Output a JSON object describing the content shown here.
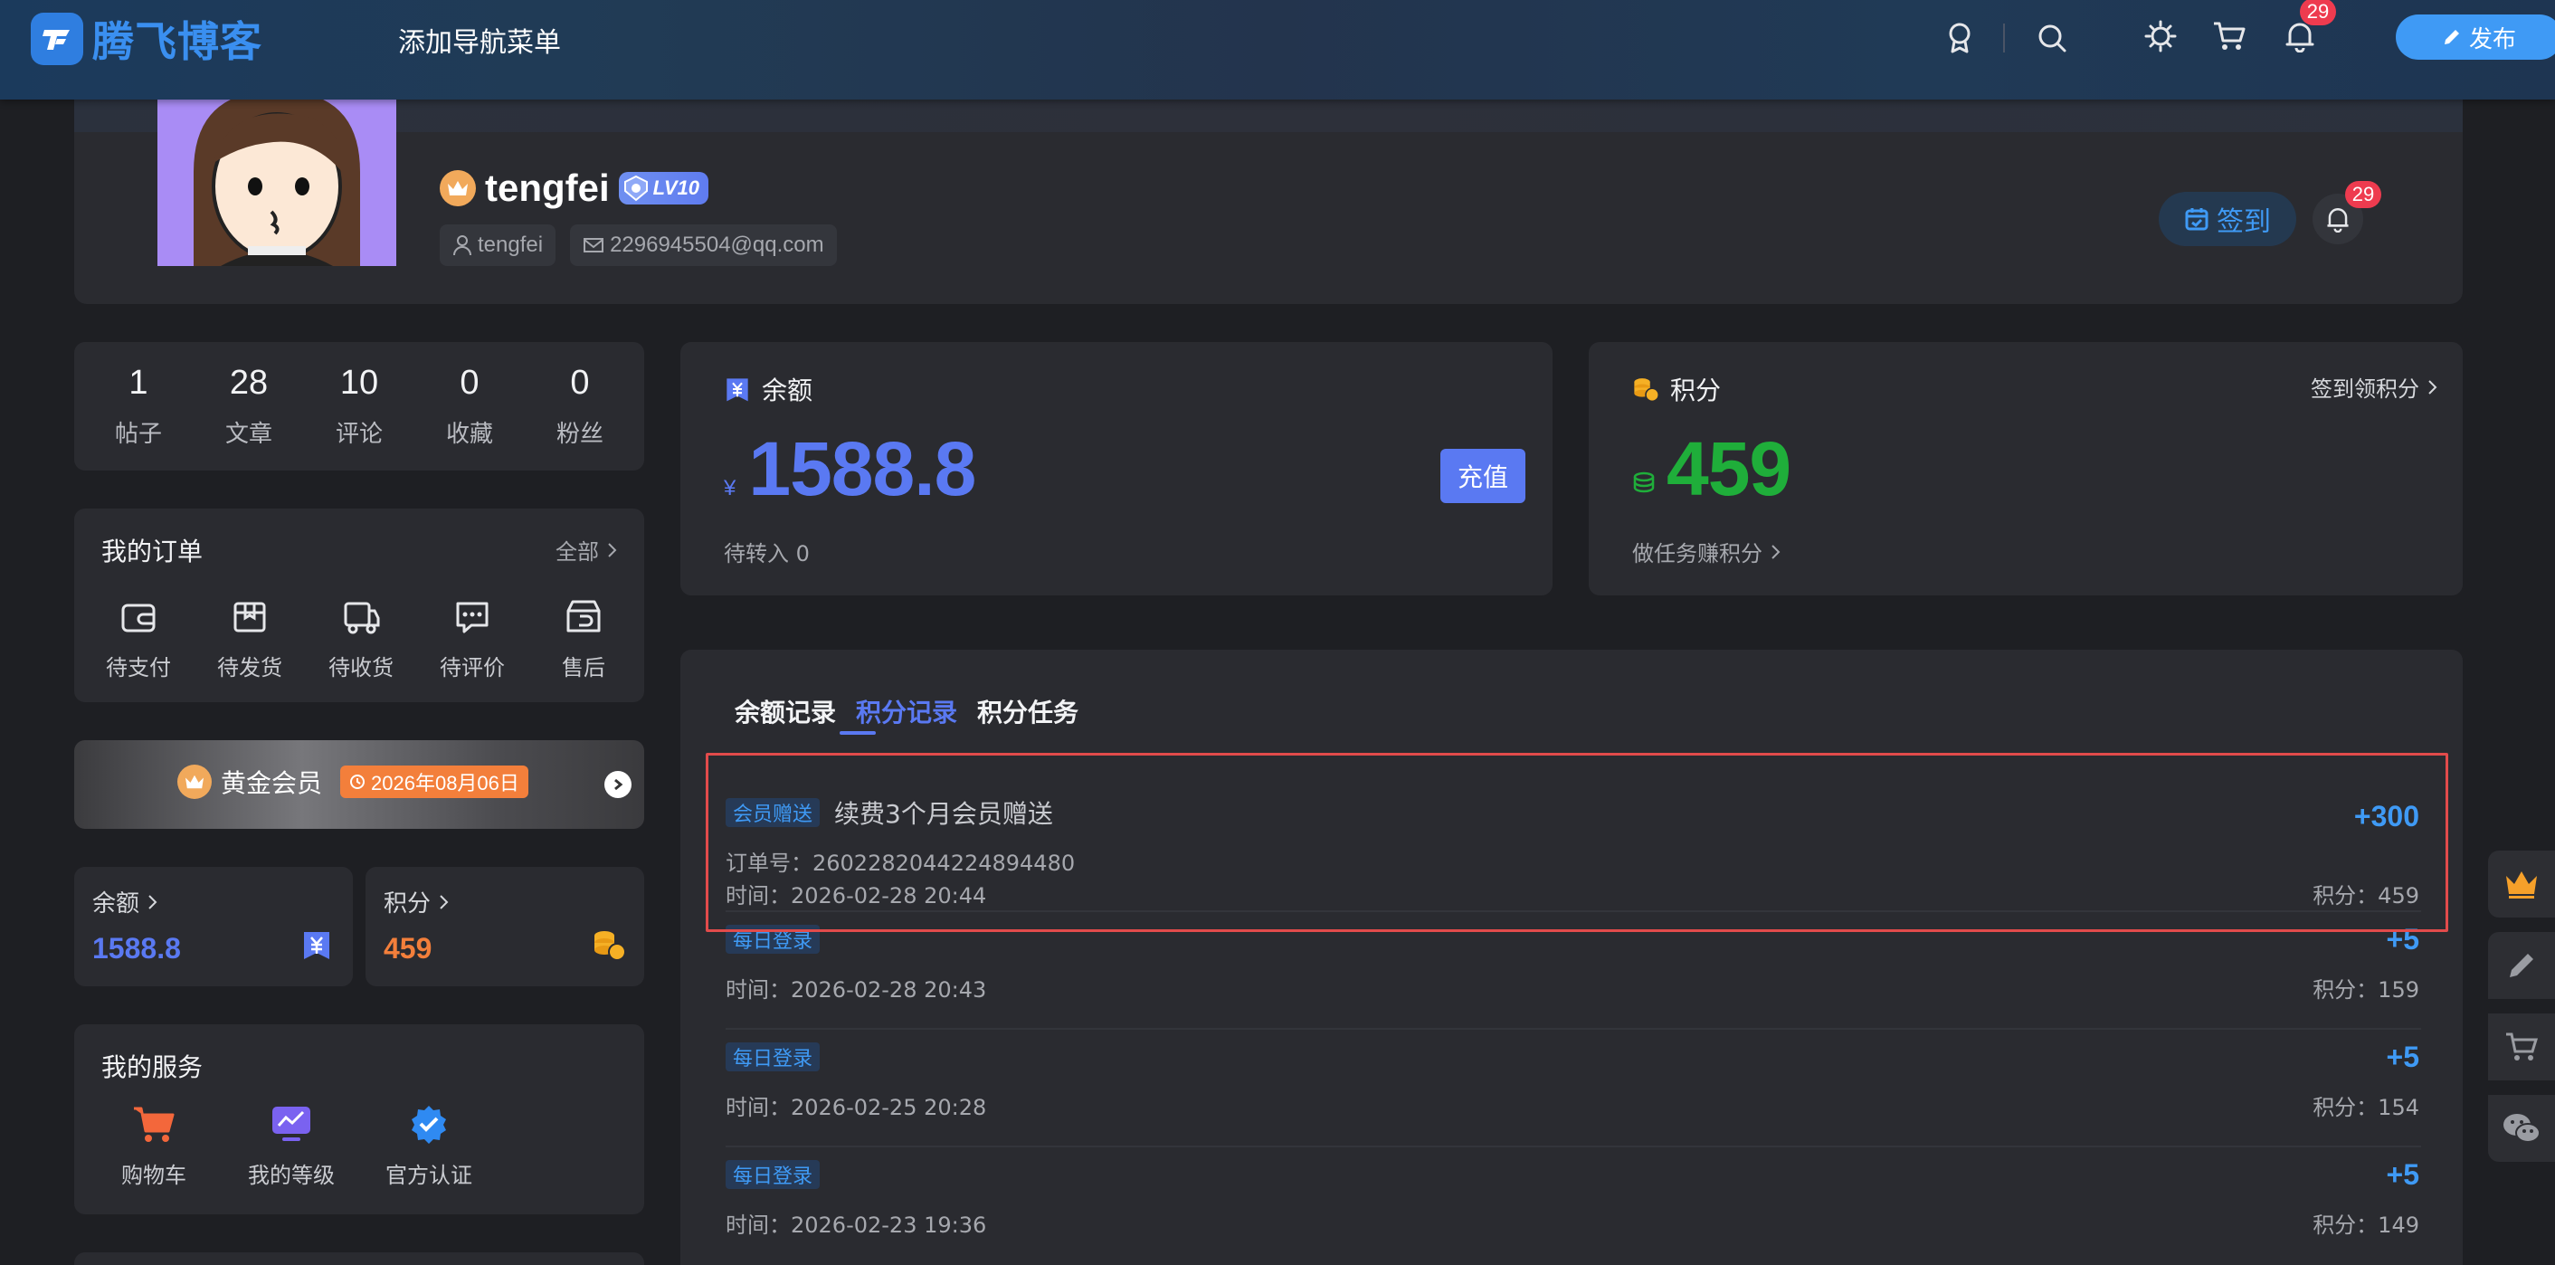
{
  "header": {
    "logo_text": "腾飞博客",
    "nav_add": "添加导航菜单",
    "notif_count": "29",
    "publish_label": "发布"
  },
  "profile": {
    "username": "tengfei",
    "level": "LV10",
    "account": "tengfei",
    "email": "2296945504@qq.com",
    "signin_label": "签到",
    "notif_count": "29"
  },
  "stats": [
    {
      "value": "1",
      "label": "帖子"
    },
    {
      "value": "28",
      "label": "文章"
    },
    {
      "value": "10",
      "label": "评论"
    },
    {
      "value": "0",
      "label": "收藏"
    },
    {
      "value": "0",
      "label": "粉丝"
    }
  ],
  "orders": {
    "title": "我的订单",
    "more": "全部",
    "items": [
      {
        "label": "待支付",
        "icon": "wallet-icon"
      },
      {
        "label": "待发货",
        "icon": "package-icon"
      },
      {
        "label": "待收货",
        "icon": "truck-icon"
      },
      {
        "label": "待评价",
        "icon": "comment-icon"
      },
      {
        "label": "售后",
        "icon": "return-icon"
      }
    ]
  },
  "vip": {
    "label": "黄金会员",
    "expire": "2026年08月06日"
  },
  "mini_cards": {
    "balance_title": "余额",
    "balance_value": "1588.8",
    "points_title": "积分",
    "points_value": "459"
  },
  "services": {
    "title": "我的服务",
    "items": [
      {
        "label": "购物车",
        "icon": "cart-icon"
      },
      {
        "label": "我的等级",
        "icon": "level-chart-icon"
      },
      {
        "label": "官方认证",
        "icon": "verified-icon"
      }
    ]
  },
  "balance_card": {
    "title": "余额",
    "currency": "¥",
    "amount": "1588.8",
    "pending": "待转入 0",
    "recharge_label": "充值"
  },
  "points_card": {
    "title": "积分",
    "link": "签到领积分",
    "amount": "459",
    "task_link": "做任务赚积分"
  },
  "records": {
    "tabs": [
      "余额记录",
      "积分记录",
      "积分任务"
    ],
    "active_tab": 1,
    "items": [
      {
        "tag": "会员赠送",
        "desc": "续费3个月会员赠送",
        "order": "订单号：2602282044224894480",
        "time": "时间：2026-02-28 20:44",
        "amount": "+300",
        "balance": "积分：459"
      },
      {
        "tag": "每日登录",
        "desc": "",
        "order": "",
        "time": "时间：2026-02-28 20:43",
        "amount": "+5",
        "balance": "积分：159"
      },
      {
        "tag": "每日登录",
        "desc": "",
        "order": "",
        "time": "时间：2026-02-25 20:28",
        "amount": "+5",
        "balance": "积分：154"
      },
      {
        "tag": "每日登录",
        "desc": "",
        "order": "",
        "time": "时间：2026-02-23 19:36",
        "amount": "+5",
        "balance": "积分：149"
      }
    ]
  },
  "colors": {
    "accent_blue": "#3f9af5",
    "indigo": "#5a79f2",
    "green": "#1fae3a",
    "orange": "#f37f3b",
    "highlight_red": "#e24b4b"
  }
}
